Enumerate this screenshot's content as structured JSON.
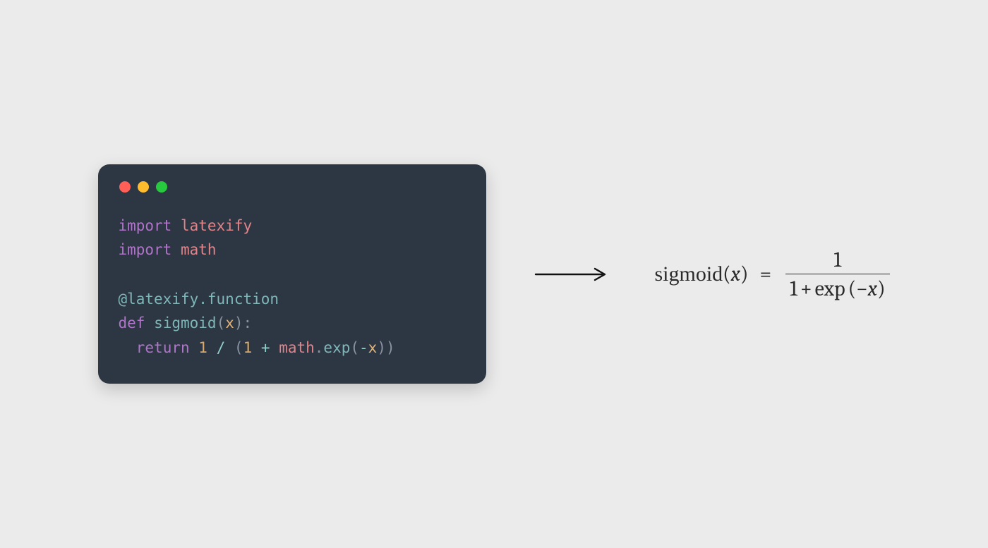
{
  "code": {
    "line1": {
      "kw": "import",
      "mod": "latexify"
    },
    "line2": {
      "kw": "import",
      "mod": "math"
    },
    "decorator": "@latexify.function",
    "def_kw": "def",
    "func_name": "sigmoid",
    "param": "x",
    "colon": ":",
    "return_kw": "return",
    "one_a": "1",
    "slash": "/",
    "lparen1": "(",
    "one_b": "1",
    "plus": "+",
    "math_obj": "math",
    "dot": ".",
    "exp_call": "exp",
    "lparen2": "(",
    "neg": "-",
    "arg": "x",
    "rparen2": ")",
    "rparen1": ")"
  },
  "formula": {
    "fn": "sigmoid",
    "lpar": "(",
    "var": "x",
    "rpar": ")",
    "eq": "=",
    "numerator": "1",
    "den_one": "1",
    "den_plus": "+",
    "den_exp": "exp",
    "den_lpar": "(",
    "den_neg": "−",
    "den_var": "x",
    "den_rpar": ")"
  }
}
